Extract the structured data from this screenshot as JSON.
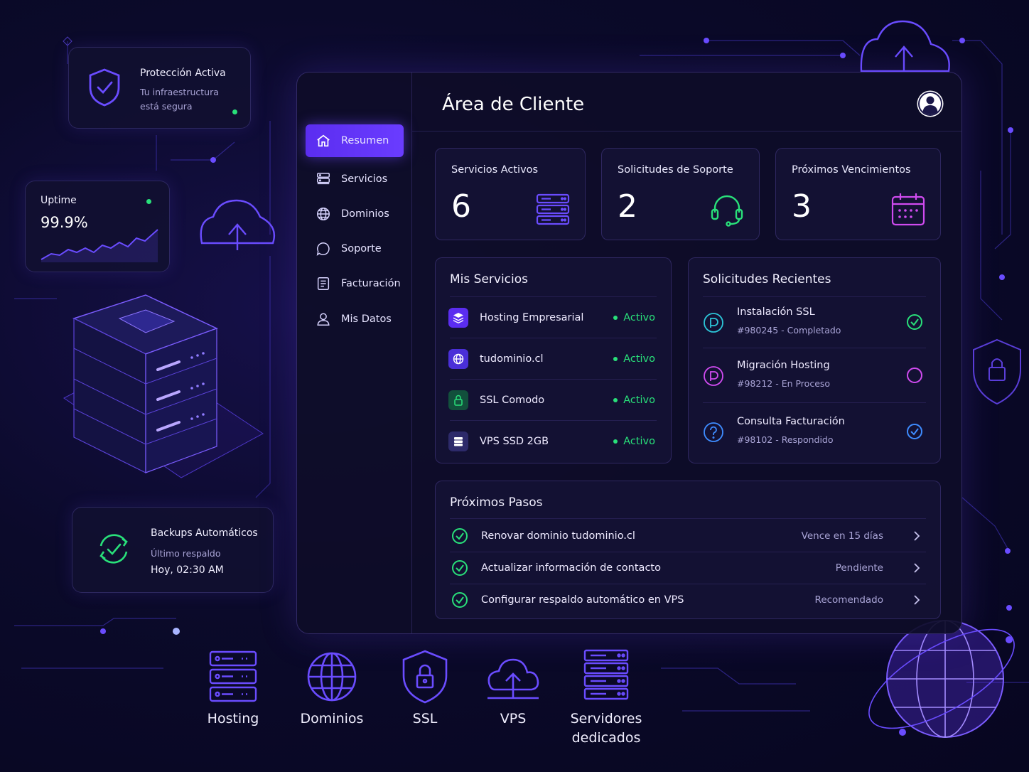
{
  "colors": {
    "accent": "#6a3cff",
    "active_green": "#29e07a",
    "cyan": "#2cc5d8",
    "magenta": "#d04bf0",
    "blue": "#3e8cff"
  },
  "protection_card": {
    "icon": "shield-check-icon",
    "title": "Protección Activa",
    "line1": "Tu infraestructura",
    "line2": "está segura"
  },
  "uptime_card": {
    "title": "Uptime",
    "value": "99.9%"
  },
  "backup_card": {
    "icon": "sync-check-icon",
    "title": "Backups Automáticos",
    "subtitle": "Último respaldo",
    "time": "Hoy, 02:30 AM"
  },
  "sidebar": {
    "items": [
      {
        "label": "Resumen",
        "icon": "home-icon",
        "active": true
      },
      {
        "label": "Servicios",
        "icon": "server-icon",
        "active": false
      },
      {
        "label": "Dominios",
        "icon": "globe-icon",
        "active": false
      },
      {
        "label": "Soporte",
        "icon": "chat-icon",
        "active": false
      },
      {
        "label": "Facturación",
        "icon": "invoice-icon",
        "active": false
      },
      {
        "label": "Mis Datos",
        "icon": "user-icon",
        "active": false
      }
    ]
  },
  "header": {
    "title": "Área de Cliente",
    "avatar_icon": "user-avatar-icon"
  },
  "stats": [
    {
      "label": "Servicios Activos",
      "value": "6",
      "icon": "server-stack-icon"
    },
    {
      "label": "Solicitudes de Soporte",
      "value": "2",
      "icon": "headset-icon"
    },
    {
      "label": "Próximos Vencimientos",
      "value": "3",
      "icon": "calendar-icon"
    }
  ],
  "services": {
    "title": "Mis Servicios",
    "items": [
      {
        "name": "Hosting Empresarial",
        "status": "Activo",
        "icon": "layers-icon"
      },
      {
        "name": "tudominio.cl",
        "status": "Activo",
        "icon": "globe-icon"
      },
      {
        "name": "SSL Comodo",
        "status": "Activo",
        "icon": "lock-icon"
      },
      {
        "name": "VPS SSD 2GB",
        "status": "Activo",
        "icon": "server-icon"
      }
    ]
  },
  "requests": {
    "title": "Solicitudes Recientes",
    "items": [
      {
        "title": "Instalación SSL",
        "sub": "#980245 - Completado",
        "icon": "ticket-icon",
        "state": "completed"
      },
      {
        "title": "Migración Hosting",
        "sub": "#98212 - En Proceso",
        "icon": "ticket-icon",
        "state": "in-progress"
      },
      {
        "title": "Consulta Facturación",
        "sub": "#98102 - Respondido",
        "icon": "question-icon",
        "state": "answered"
      }
    ]
  },
  "next_steps": {
    "title": "Próximos Pasos",
    "items": [
      {
        "text": "Renovar dominio tudominio.cl",
        "meta": "Vence en 15 días"
      },
      {
        "text": "Actualizar información de contacto",
        "meta": "Pendiente"
      },
      {
        "text": "Configurar respaldo automático en VPS",
        "meta": "Recomendado"
      }
    ]
  },
  "bottom_services": [
    {
      "label": "Hosting",
      "icon": "server-stack-icon"
    },
    {
      "label": "Dominios",
      "icon": "globe-icon"
    },
    {
      "label": "SSL",
      "icon": "shield-lock-icon"
    },
    {
      "label": "VPS",
      "icon": "cloud-upload-icon"
    },
    {
      "label": "Servidores",
      "label2": "dedicados",
      "icon": "server-rack-icon"
    }
  ]
}
